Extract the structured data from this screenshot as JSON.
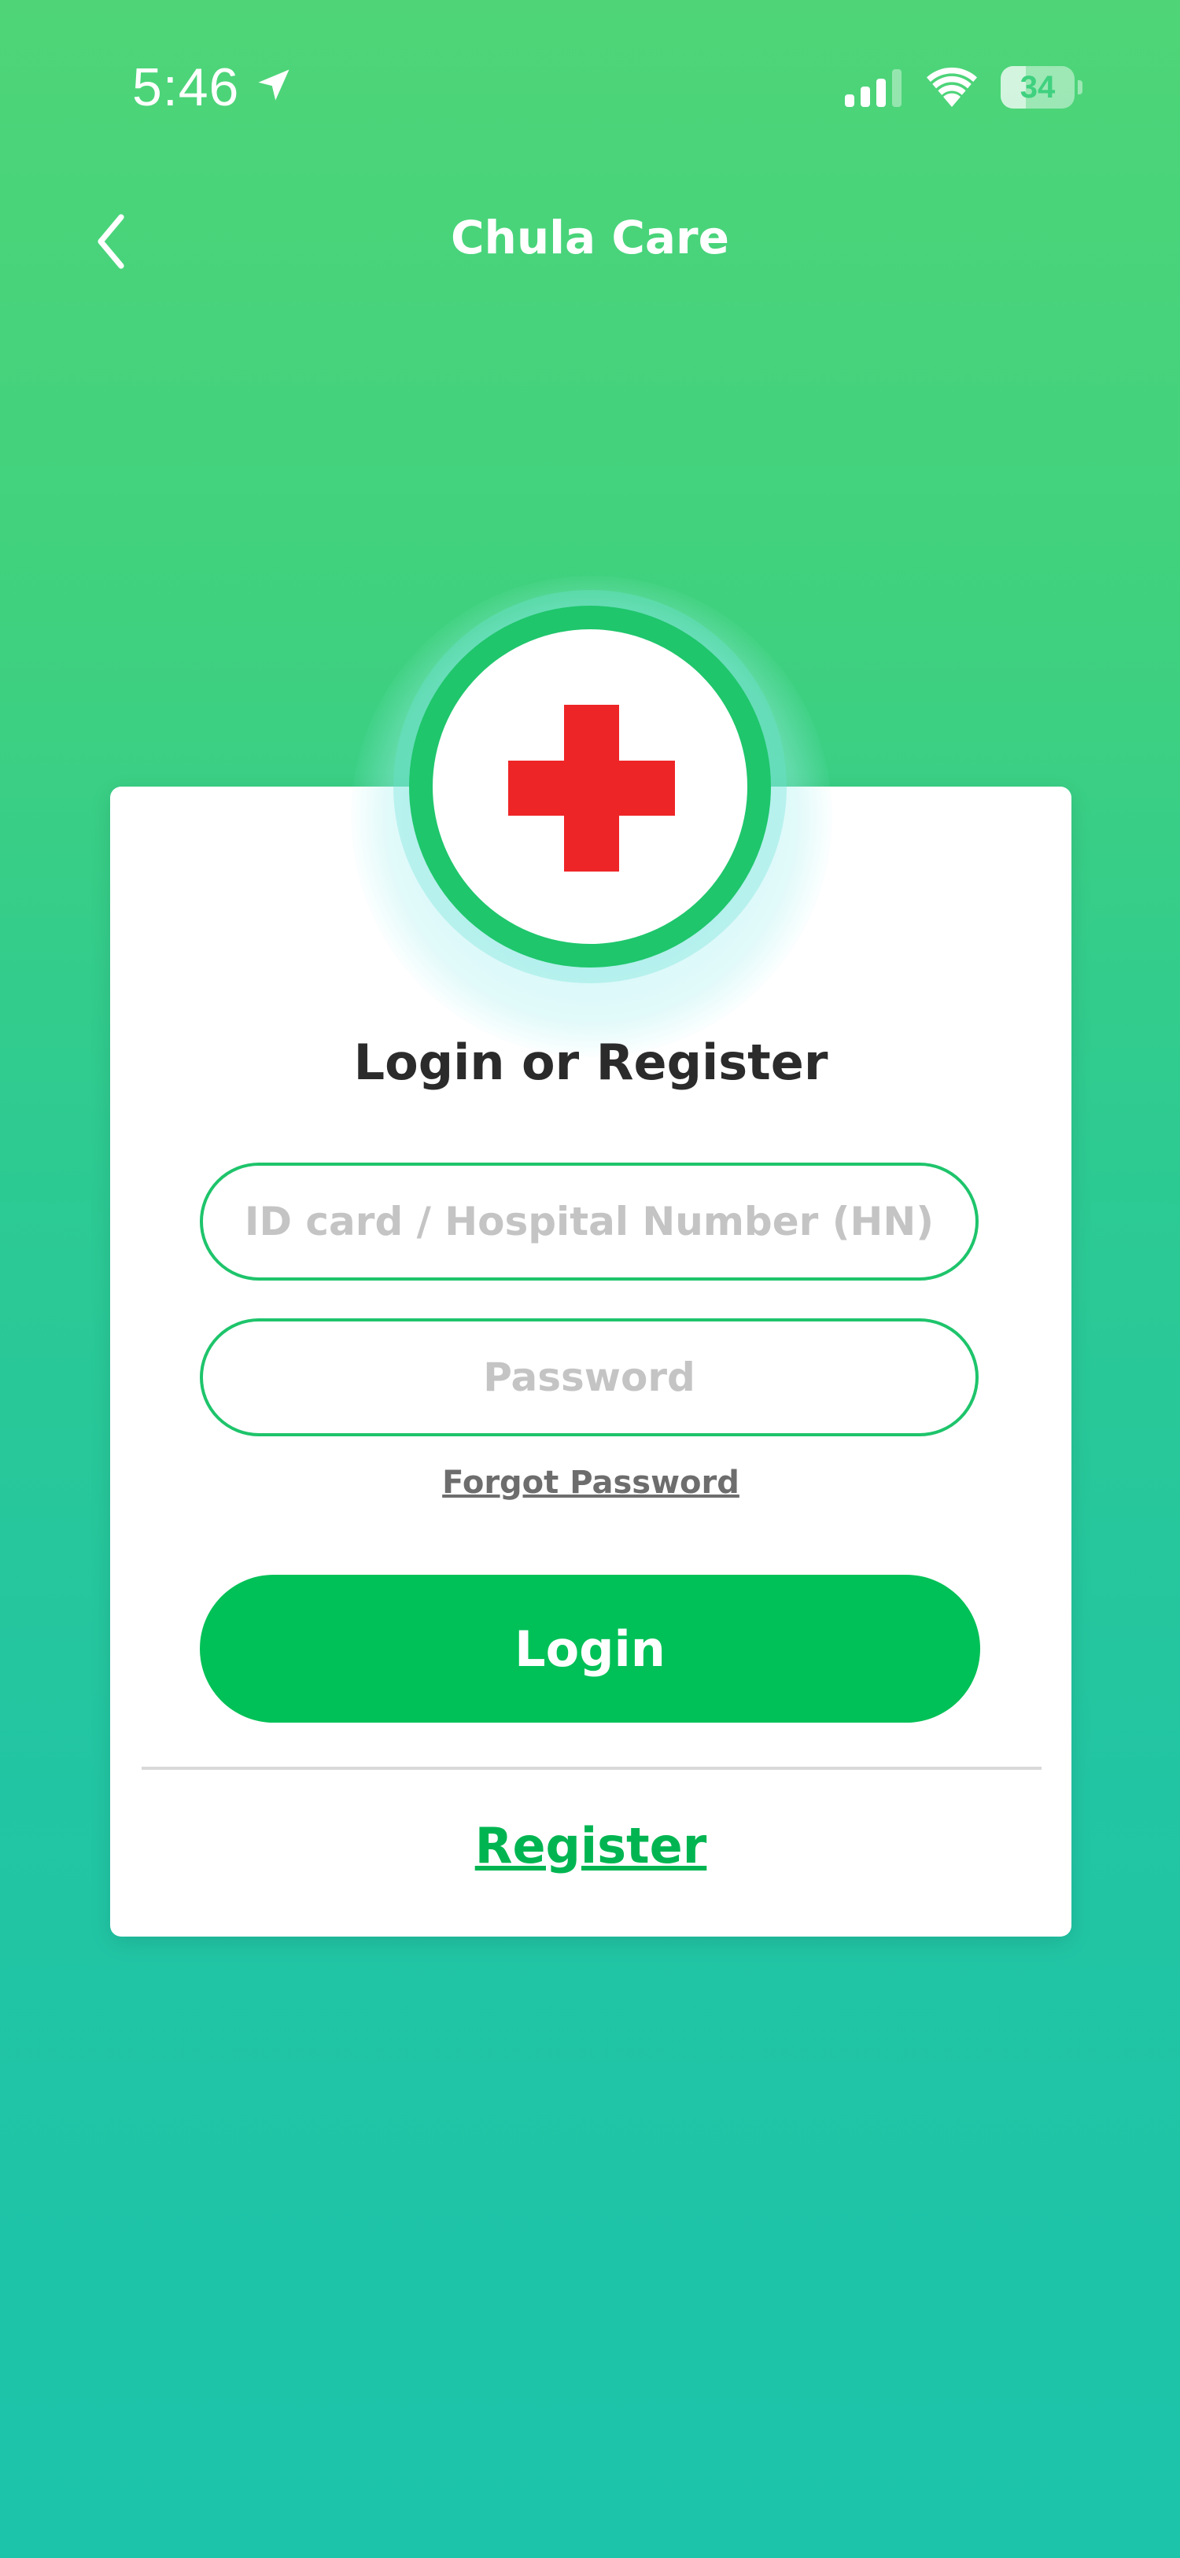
{
  "status_bar": {
    "time": "5:46",
    "battery_percent": "34",
    "battery_level": 0.34,
    "icons": [
      "location-arrow-icon",
      "signal-icon",
      "wifi-icon",
      "battery-icon"
    ]
  },
  "nav": {
    "back_icon": "chevron-left-icon",
    "title": "Chula Care"
  },
  "logo": {
    "icon": "red-cross-icon",
    "cross_color": "#ee2527",
    "ring_color": "#1fc66c"
  },
  "login_form": {
    "title": "Login or Register",
    "id_placeholder": "ID card / Hospital Number (HN)",
    "id_value": "",
    "password_placeholder": "Password",
    "password_value": "",
    "forgot_password": "Forgot Password",
    "login_label": "Login",
    "register_label": "Register"
  },
  "colors": {
    "accent": "#00c157",
    "input_border": "#1ec46b",
    "background_top": "#4fd578",
    "background_bottom": "#1cc4aa"
  }
}
